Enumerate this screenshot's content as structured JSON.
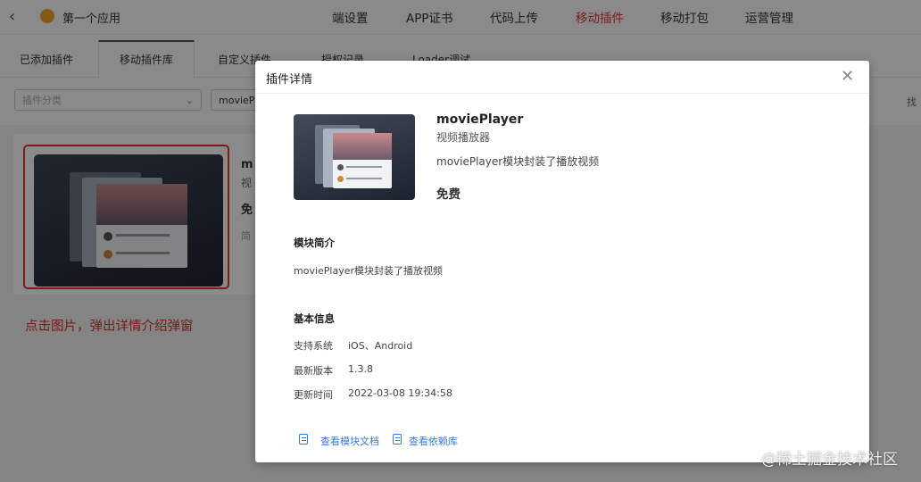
{
  "topnav": {
    "back_icon": "chevron-left-icon",
    "app_name": "第一个应用",
    "items": [
      "端设置",
      "APP证书",
      "代码上传",
      "移动插件",
      "移动打包",
      "运营管理"
    ],
    "active_item": "移动插件",
    "active_color": "#e0312f"
  },
  "subtabs": {
    "items": [
      "已添加插件",
      "移动插件库",
      "自定义插件",
      "授权记录",
      "Loader调试"
    ],
    "active": "移动插件库"
  },
  "filters": {
    "category_placeholder": "插件分类",
    "search_value": "movieP",
    "right_text": "找"
  },
  "card": {
    "title_partial": "m",
    "subtitle_partial": "视",
    "price_partial": "免",
    "extra_partial": "简"
  },
  "annotation": {
    "text": "点击图片，弹出详情介绍弹窗",
    "color": "#e0312f"
  },
  "modal": {
    "title": "插件详情",
    "close_icon": "close-icon",
    "plugin": {
      "name": "moviePlayer",
      "subtitle": "视频播放器",
      "description": "moviePlayer模块封装了播放视频",
      "price": "免费"
    },
    "intro": {
      "title": "模块简介",
      "text": "moviePlayer模块封装了播放视频"
    },
    "basic_info": {
      "title": "基本信息",
      "rows": [
        {
          "label": "支持系统",
          "value": "iOS、Android"
        },
        {
          "label": "最新版本",
          "value": "1.3.8"
        },
        {
          "label": "更新时间",
          "value": "2022-03-08 19:34:58"
        }
      ]
    },
    "links": [
      {
        "label": "查看模块文档",
        "icon": "document-icon"
      },
      {
        "label": "查看依赖库",
        "icon": "document-icon"
      }
    ],
    "link_color": "#3b79d6"
  },
  "watermark": "@稀土掘金技术社区"
}
